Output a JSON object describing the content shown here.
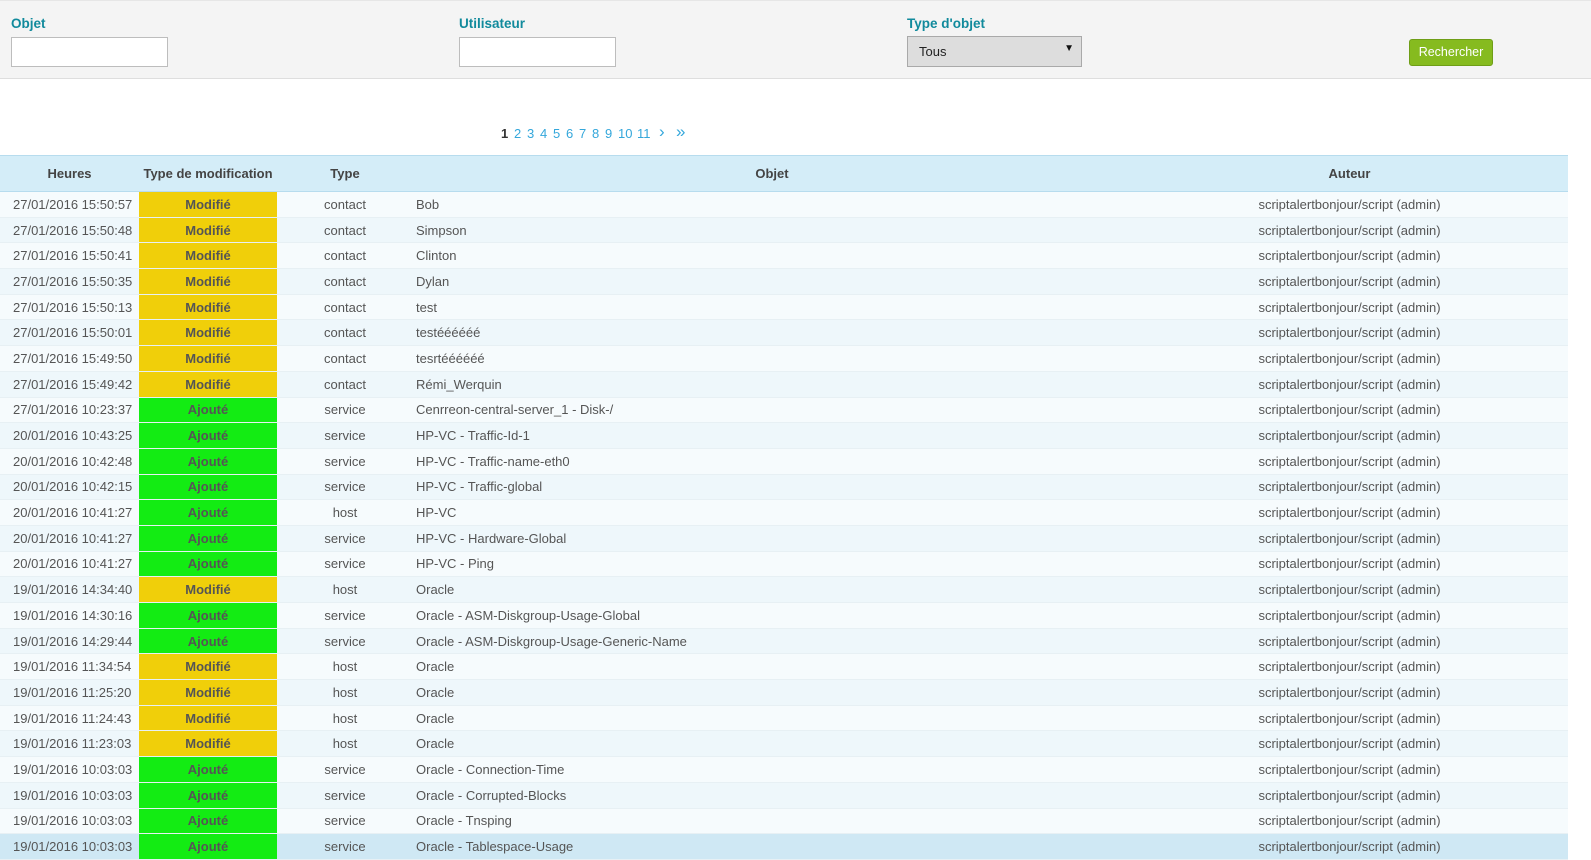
{
  "filters": {
    "objet_label": "Objet",
    "objet_value": "",
    "utilisateur_label": "Utilisateur",
    "utilisateur_value": "",
    "type_label": "Type d'objet",
    "type_selected": "Tous",
    "search_button": "Rechercher"
  },
  "pagination": {
    "pages": [
      "1",
      "2",
      "3",
      "4",
      "5",
      "6",
      "7",
      "8",
      "9",
      "10",
      "11"
    ],
    "current": "1",
    "next": "›",
    "last": "»"
  },
  "colors": {
    "modifie": "#f0cf0a",
    "ajoute": "#13ec13",
    "accent": "#118a9c",
    "link": "#34a7db",
    "button": "#86bb1f"
  },
  "table": {
    "headers": {
      "time": "Heures",
      "mod": "Type de modification",
      "type": "Type",
      "object": "Objet",
      "author": "Auteur"
    },
    "rows": [
      {
        "time": "27/01/2016 15:50:57",
        "mod": "Modifié",
        "type": "contact",
        "object": "Bob",
        "author": "scriptalertbonjour/script (admin)"
      },
      {
        "time": "27/01/2016 15:50:48",
        "mod": "Modifié",
        "type": "contact",
        "object": "Simpson",
        "author": "scriptalertbonjour/script (admin)"
      },
      {
        "time": "27/01/2016 15:50:41",
        "mod": "Modifié",
        "type": "contact",
        "object": "Clinton",
        "author": "scriptalertbonjour/script (admin)"
      },
      {
        "time": "27/01/2016 15:50:35",
        "mod": "Modifié",
        "type": "contact",
        "object": "Dylan",
        "author": "scriptalertbonjour/script (admin)"
      },
      {
        "time": "27/01/2016 15:50:13",
        "mod": "Modifié",
        "type": "contact",
        "object": "test",
        "author": "scriptalertbonjour/script (admin)"
      },
      {
        "time": "27/01/2016 15:50:01",
        "mod": "Modifié",
        "type": "contact",
        "object": "testéééééé",
        "author": "scriptalertbonjour/script (admin)"
      },
      {
        "time": "27/01/2016 15:49:50",
        "mod": "Modifié",
        "type": "contact",
        "object": "tesrtéééééé",
        "author": "scriptalertbonjour/script (admin)"
      },
      {
        "time": "27/01/2016 15:49:42",
        "mod": "Modifié",
        "type": "contact",
        "object": "Rémi_Werquin",
        "author": "scriptalertbonjour/script (admin)"
      },
      {
        "time": "27/01/2016 10:23:37",
        "mod": "Ajouté",
        "type": "service",
        "object": "Cenrreon-central-server_1 - Disk-/",
        "author": "scriptalertbonjour/script (admin)"
      },
      {
        "time": "20/01/2016 10:43:25",
        "mod": "Ajouté",
        "type": "service",
        "object": "HP-VC - Traffic-Id-1",
        "author": "scriptalertbonjour/script (admin)"
      },
      {
        "time": "20/01/2016 10:42:48",
        "mod": "Ajouté",
        "type": "service",
        "object": "HP-VC - Traffic-name-eth0",
        "author": "scriptalertbonjour/script (admin)"
      },
      {
        "time": "20/01/2016 10:42:15",
        "mod": "Ajouté",
        "type": "service",
        "object": "HP-VC - Traffic-global",
        "author": "scriptalertbonjour/script (admin)"
      },
      {
        "time": "20/01/2016 10:41:27",
        "mod": "Ajouté",
        "type": "host",
        "object": "HP-VC",
        "author": "scriptalertbonjour/script (admin)"
      },
      {
        "time": "20/01/2016 10:41:27",
        "mod": "Ajouté",
        "type": "service",
        "object": "HP-VC - Hardware-Global",
        "author": "scriptalertbonjour/script (admin)"
      },
      {
        "time": "20/01/2016 10:41:27",
        "mod": "Ajouté",
        "type": "service",
        "object": "HP-VC - Ping",
        "author": "scriptalertbonjour/script (admin)"
      },
      {
        "time": "19/01/2016 14:34:40",
        "mod": "Modifié",
        "type": "host",
        "object": "Oracle",
        "author": "scriptalertbonjour/script (admin)"
      },
      {
        "time": "19/01/2016 14:30:16",
        "mod": "Ajouté",
        "type": "service",
        "object": "Oracle - ASM-Diskgroup-Usage-Global",
        "author": "scriptalertbonjour/script (admin)"
      },
      {
        "time": "19/01/2016 14:29:44",
        "mod": "Ajouté",
        "type": "service",
        "object": "Oracle - ASM-Diskgroup-Usage-Generic-Name",
        "author": "scriptalertbonjour/script (admin)"
      },
      {
        "time": "19/01/2016 11:34:54",
        "mod": "Modifié",
        "type": "host",
        "object": "Oracle",
        "author": "scriptalertbonjour/script (admin)"
      },
      {
        "time": "19/01/2016 11:25:20",
        "mod": "Modifié",
        "type": "host",
        "object": "Oracle",
        "author": "scriptalertbonjour/script (admin)"
      },
      {
        "time": "19/01/2016 11:24:43",
        "mod": "Modifié",
        "type": "host",
        "object": "Oracle",
        "author": "scriptalertbonjour/script (admin)"
      },
      {
        "time": "19/01/2016 11:23:03",
        "mod": "Modifié",
        "type": "host",
        "object": "Oracle",
        "author": "scriptalertbonjour/script (admin)"
      },
      {
        "time": "19/01/2016 10:03:03",
        "mod": "Ajouté",
        "type": "service",
        "object": "Oracle - Connection-Time",
        "author": "scriptalertbonjour/script (admin)"
      },
      {
        "time": "19/01/2016 10:03:03",
        "mod": "Ajouté",
        "type": "service",
        "object": "Oracle - Corrupted-Blocks",
        "author": "scriptalertbonjour/script (admin)"
      },
      {
        "time": "19/01/2016 10:03:03",
        "mod": "Ajouté",
        "type": "service",
        "object": "Oracle - Tnsping",
        "author": "scriptalertbonjour/script (admin)"
      },
      {
        "time": "19/01/2016 10:03:03",
        "mod": "Ajouté",
        "type": "service",
        "object": "Oracle - Tablespace-Usage",
        "author": "scriptalertbonjour/script (admin)"
      }
    ]
  }
}
